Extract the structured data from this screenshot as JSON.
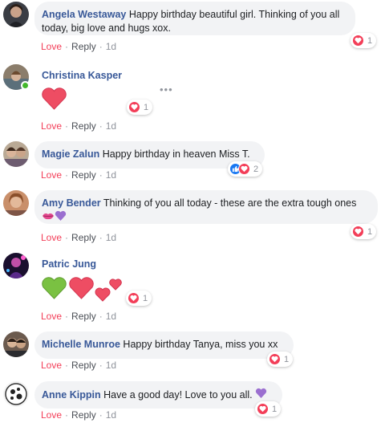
{
  "comments": [
    {
      "author": "Angela Westaway",
      "text": "Happy birthday beautiful girl. Thinking of you all today, big love and hugs xox.",
      "text_line1": "Happy birthday beautiful girl. Thinking of you all",
      "text_line2": "today, big love and hugs xox.",
      "reaction_count": "1",
      "love": "Love",
      "reply": "Reply",
      "time": "1d"
    },
    {
      "author": "Christina Kasper",
      "emoji": "heart",
      "reaction_count": "1",
      "love": "Love",
      "reply": "Reply",
      "time": "1d"
    },
    {
      "author": "Magie Zalun",
      "text": "Happy birthday in heaven Miss T.",
      "reaction_count": "2",
      "love": "Love",
      "reply": "Reply",
      "time": "1d"
    },
    {
      "author": "Amy Bender",
      "text": "Thinking of you all today - these are the extra tough ones",
      "emoji": "kiss-lips, purple-heart",
      "reaction_count": "1",
      "love": "Love",
      "reply": "Reply",
      "time": "1d"
    },
    {
      "author": "Patric Jung",
      "emoji": "green-heart, red-heart, two-hearts",
      "reaction_count": "1",
      "love": "Love",
      "reply": "Reply",
      "time": "1d"
    },
    {
      "author": "Michelle Munroe",
      "text": "Happy birthday Tanya, miss you xx",
      "reaction_count": "1",
      "love": "Love",
      "reply": "Reply",
      "time": "1d"
    },
    {
      "author": "Anne Kippin",
      "text": "Have a good day! Love to you all.",
      "emoji": "purple-heart",
      "reaction_count": "1",
      "love": "Love",
      "reply": "Reply",
      "time": "1d"
    }
  ],
  "colors": {
    "author": "#385898",
    "love_action": "#f33e58",
    "bubble": "#f2f3f5",
    "online": "#42b72a"
  }
}
